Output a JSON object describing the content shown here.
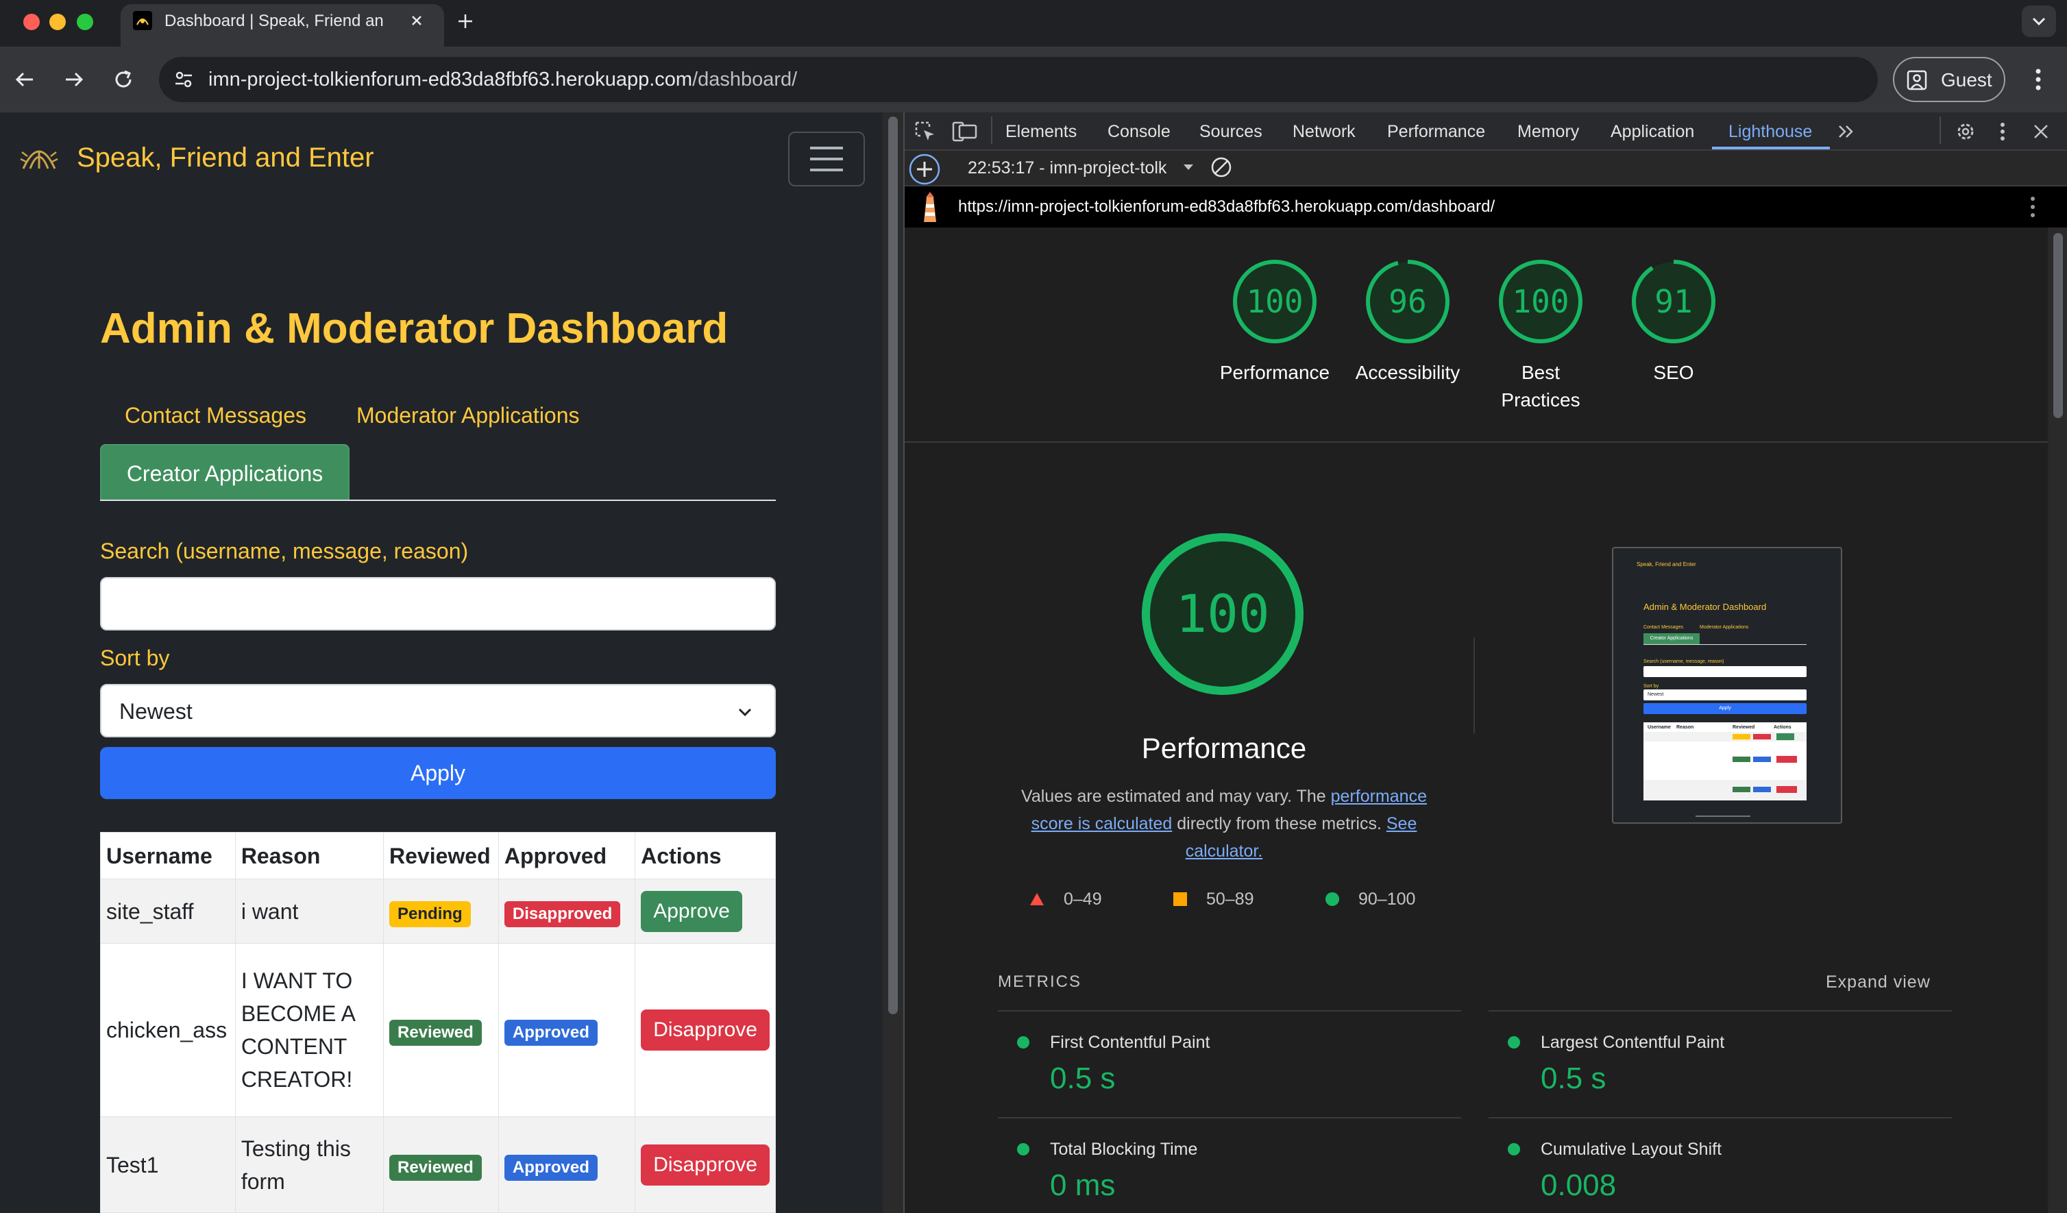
{
  "browser": {
    "tab_title": "Dashboard | Speak, Friend an",
    "url_host": "imn-project-tolkienforum-ed83da8fbf63.herokuapp.com",
    "url_path": "/dashboard/",
    "guest_label": "Guest"
  },
  "site": {
    "brand": "Speak, Friend and Enter",
    "page_title": "Admin & Moderator Dashboard",
    "nav_tabs": [
      "Contact Messages",
      "Moderator Applications",
      "Creator Applications"
    ],
    "active_tab": "Creator Applications",
    "search_label": "Search (username, message, reason)",
    "search_value": "",
    "sort_label": "Sort by",
    "sort_value": "Newest",
    "apply_label": "Apply",
    "table": {
      "headers": [
        "Username",
        "Reason",
        "Reviewed",
        "Approved",
        "Actions"
      ],
      "rows": [
        {
          "username": "site_staff",
          "reason": "i want",
          "reviewed": "Pending",
          "approved": "Disapproved",
          "action": "Approve"
        },
        {
          "username": "chicken_ass",
          "reason": "I WANT TO BECOME A CONTENT CREATOR!",
          "reviewed": "Reviewed",
          "approved": "Approved",
          "action": "Disapprove"
        },
        {
          "username": "Test1",
          "reason": "Testing this form",
          "reviewed": "Reviewed",
          "approved": "Approved",
          "action": "Disapprove"
        }
      ]
    }
  },
  "devtools": {
    "tabs": [
      "Elements",
      "Console",
      "Sources",
      "Network",
      "Performance",
      "Memory",
      "Application",
      "Lighthouse"
    ],
    "active_tab": "Lighthouse",
    "report_selector": "22:53:17 - imn-project-tolk",
    "report_url": "https://imn-project-tolkienforum-ed83da8fbf63.herokuapp.com/dashboard/",
    "scores": [
      {
        "label": "Performance",
        "value": "100"
      },
      {
        "label": "Accessibility",
        "value": "96"
      },
      {
        "label": "Best Practices",
        "value": "100"
      },
      {
        "label": "SEO",
        "value": "91"
      }
    ],
    "main_score": {
      "label": "Performance",
      "value": "100"
    },
    "desc": {
      "part1": "Values are estimated and may vary. The ",
      "link1": "performance score is calculated",
      "part2": " directly from these metrics. ",
      "link2": "See calculator."
    },
    "legend": [
      "0–49",
      "50–89",
      "90–100"
    ],
    "metrics_title": "METRICS",
    "expand_label": "Expand view",
    "metrics": [
      {
        "label": "First Contentful Paint",
        "value": "0.5 s"
      },
      {
        "label": "Largest Contentful Paint",
        "value": "0.5 s"
      },
      {
        "label": "Total Blocking Time",
        "value": "0 ms"
      },
      {
        "label": "Cumulative Layout Shift",
        "value": "0.008"
      }
    ],
    "colors": {
      "pass": "#18b663",
      "average": "#ffa400",
      "fail": "#ff4e42",
      "link": "#7cacf8"
    }
  }
}
